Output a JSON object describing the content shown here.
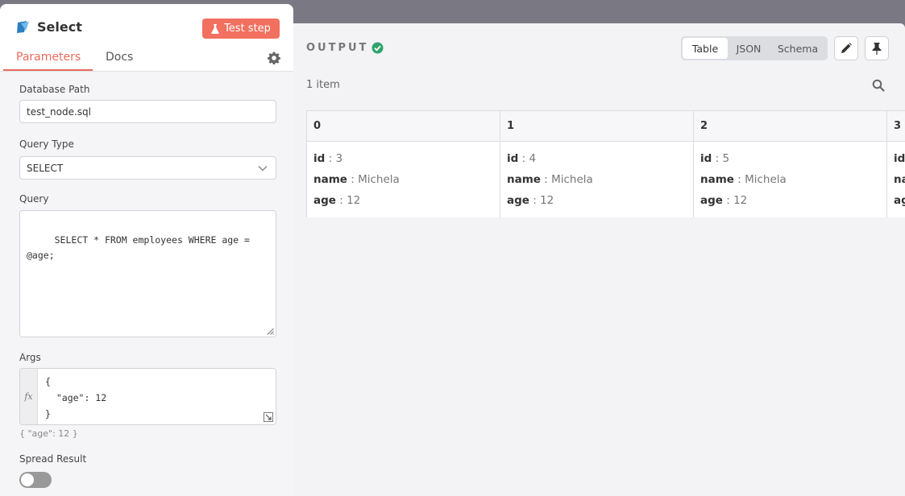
{
  "node": {
    "title": "Select",
    "test_button": "Test step",
    "tabs": [
      "Parameters",
      "Docs"
    ]
  },
  "params": {
    "db_path_label": "Database Path",
    "db_path_value": "test_node.sql",
    "query_type_label": "Query Type",
    "query_type_value": "SELECT",
    "query_label": "Query",
    "query_value": " SELECT * FROM employees WHERE age =\n@age;",
    "args_label": "Args",
    "args_value": "{\n  \"age\": 12\n}",
    "args_result": "{  \"age\": 12 }",
    "spread_label": "Spread Result",
    "spread_on": false
  },
  "output": {
    "title": "OUTPUT",
    "views": [
      "Table",
      "JSON",
      "Schema"
    ],
    "active_view": "Table",
    "item_count": "1 item",
    "columns": [
      "0",
      "1",
      "2",
      "3"
    ],
    "rows": [
      [
        [
          [
            "id",
            "3"
          ],
          [
            "name",
            "Michela"
          ],
          [
            "age",
            "12"
          ]
        ],
        [
          [
            "id",
            "4"
          ],
          [
            "name",
            "Michela"
          ],
          [
            "age",
            "12"
          ]
        ],
        [
          [
            "id",
            "5"
          ],
          [
            "name",
            "Michela"
          ],
          [
            "age",
            "12"
          ]
        ],
        [
          [
            "id",
            ""
          ],
          [
            "name",
            ""
          ],
          [
            "age",
            ""
          ]
        ]
      ]
    ]
  },
  "colors": {
    "accent": "#ea6a5b",
    "test_button": "#f2705f",
    "success": "#2fa36b"
  },
  "icons": [
    "node-icon",
    "flask-icon",
    "gear-icon",
    "chevron-down-icon",
    "resize-handle-icon",
    "expand-icon",
    "check-circle-icon",
    "pencil-icon",
    "pin-icon",
    "search-icon"
  ]
}
